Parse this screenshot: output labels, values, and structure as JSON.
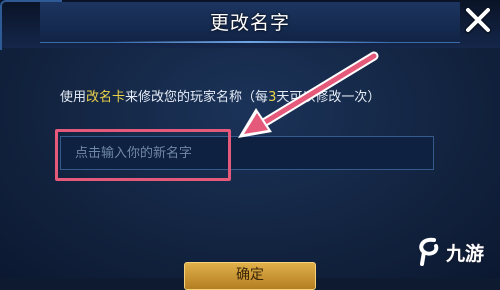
{
  "dialog": {
    "title": "更改名字",
    "description": {
      "prefix": "使用",
      "card_name": "改名卡",
      "middle": "来修改您的玩家名称（",
      "hidden": "每",
      "days": "3",
      "suffix": "天可以修改一次）"
    },
    "input": {
      "placeholder": "点击输入你的新名字",
      "value": ""
    },
    "confirm_label": "确定"
  },
  "watermark": {
    "text": "九游"
  },
  "colors": {
    "highlight": "#e55a7a",
    "accent_yellow": "#e9d24a",
    "background": "#12233f"
  }
}
